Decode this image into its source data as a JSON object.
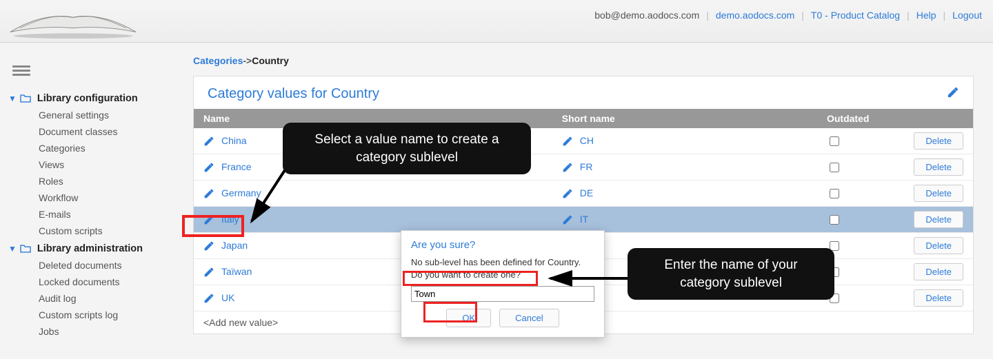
{
  "header": {
    "user": "bob@demo.aodocs.com",
    "links": [
      "demo.aodocs.com",
      "T0 - Product Catalog",
      "Help",
      "Logout"
    ]
  },
  "sidebar": {
    "sections": [
      {
        "title": "Library configuration",
        "items": [
          "General settings",
          "Document classes",
          "Categories",
          "Views",
          "Roles",
          "Workflow",
          "E-mails",
          "Custom scripts"
        ]
      },
      {
        "title": "Library administration",
        "items": [
          "Deleted documents",
          "Locked documents",
          "Audit log",
          "Custom scripts log",
          "Jobs"
        ]
      }
    ]
  },
  "breadcrumb": {
    "root": "Categories",
    "sep": "->",
    "current": "Country"
  },
  "panel": {
    "title": "Category values for Country"
  },
  "table": {
    "cols": {
      "name": "Name",
      "short": "Short name",
      "outdated": "Outdated",
      "actions": ""
    },
    "rows": [
      {
        "name": "China",
        "short": "CH",
        "selected": false
      },
      {
        "name": "France",
        "short": "FR",
        "selected": false
      },
      {
        "name": "Germany",
        "short": "DE",
        "selected": false
      },
      {
        "name": "Italy",
        "short": "IT",
        "selected": true
      },
      {
        "name": "Japan",
        "short": "",
        "selected": false
      },
      {
        "name": "Taïwan",
        "short": "",
        "selected": false
      },
      {
        "name": "UK",
        "short": "",
        "selected": false
      }
    ],
    "delete_label": "Delete",
    "add_new_label": "<Add new value>"
  },
  "dialog": {
    "title": "Are you sure?",
    "body": "No sub-level has been defined for Country. Do you want to create one?",
    "input_value": "Town",
    "ok": "OK",
    "cancel": "Cancel"
  },
  "callouts": {
    "c1": "Select a value name to create a category sublevel",
    "c2": "Enter the name of your category sublevel"
  }
}
